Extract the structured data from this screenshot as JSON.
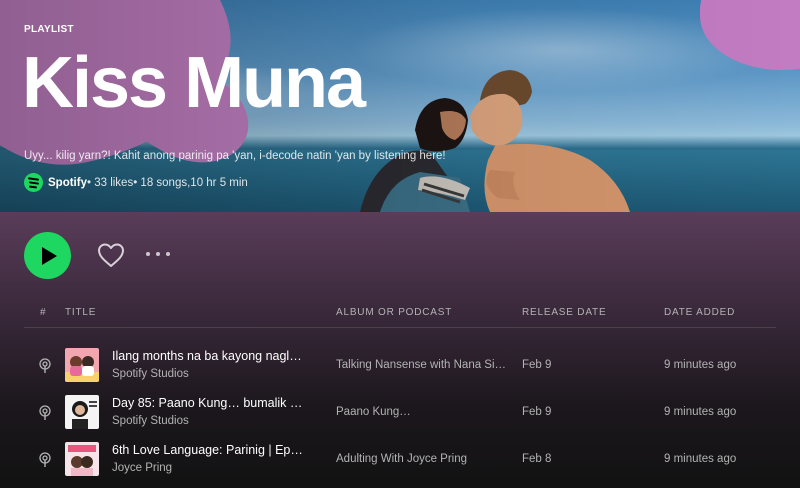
{
  "hero": {
    "type_label": "PLAYLIST",
    "title": "Kiss Muna",
    "description": "Uyy... kilig yarn?! Kahit anong parinig pa 'yan, i-decode natin 'yan by listening here!",
    "owner": "Spotify",
    "likes": " • 33 likes",
    "songs": " • 18 songs,",
    "duration": " 10 hr 5 min"
  },
  "actions": {
    "play_icon": "play-icon",
    "like_icon": "heart-outline-icon",
    "more_icon": "more-horizontal-icon"
  },
  "table": {
    "headers": {
      "number": "#",
      "title": "TITLE",
      "album": "ALBUM OR PODCAST",
      "release": "RELEASE DATE",
      "added": "DATE ADDED"
    },
    "rows": [
      {
        "title": "Ilang months na ba kayong nagl…",
        "subtitle": "Spotify Studios",
        "album": "Talking Nansense with Nana Si…",
        "release": "Feb 9",
        "added": "9 minutes ago",
        "icon": "podcast-icon"
      },
      {
        "title": "Day 85: Paano Kung… bumalik …",
        "subtitle": "Spotify Studios",
        "album": "Paano Kung…",
        "release": "Feb 9",
        "added": "9 minutes ago",
        "icon": "podcast-icon"
      },
      {
        "title": "6th Love Language: Parinig | Ep…",
        "subtitle": "Joyce Pring",
        "album": "Adulting With Joyce Pring",
        "release": "Feb 8",
        "added": "9 minutes ago",
        "icon": "podcast-icon"
      }
    ]
  },
  "colors": {
    "accent": "#1ed760",
    "blob": "#c17fc1",
    "header_gradient": "#5a3d59"
  }
}
